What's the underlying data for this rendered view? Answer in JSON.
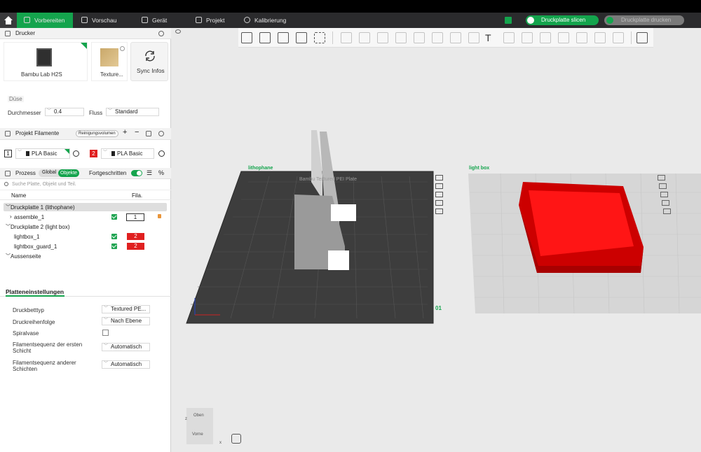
{
  "menubar": {
    "tabs": [
      {
        "label": "Vorbereiten"
      },
      {
        "label": "Vorschau"
      },
      {
        "label": "Gerät"
      },
      {
        "label": "Projekt"
      },
      {
        "label": "Kalibrierung"
      }
    ],
    "slice_button": "Druckplatte slicen",
    "print_button": "Druckplatte drucken"
  },
  "printer": {
    "section_title": "Drucker",
    "printer_name": "Bambu Lab H2S",
    "plate_name": "Texture...",
    "sync_label": "Sync Infos",
    "nozzle_label": "Düse",
    "diameter_label": "Durchmesser",
    "diameter_value": "0.4",
    "flow_label": "Fluss",
    "flow_value": "Standard"
  },
  "filaments": {
    "section_title": "Projekt Filamente",
    "purge_badge": "Reinigungsvolumen",
    "items": [
      {
        "index": "1",
        "name": "PLA Basic",
        "color": "#ffffff"
      },
      {
        "index": "2",
        "name": "PLA Basic",
        "color": "#e02020"
      }
    ]
  },
  "process": {
    "section_title": "Prozess",
    "global_label": "Global",
    "objects_label": "Objekte",
    "advanced_label": "Fortgeschritten",
    "search_placeholder": "Suche Platte, Objekt und Teil.",
    "col_name": "Name",
    "col_fila": "Fila."
  },
  "tree": {
    "plate1": "Druckplatte 1 (lithophane)",
    "assemble": "assemble_1",
    "assemble_fila": "1",
    "plate2": "Druckplatte 2 (light box)",
    "lightbox": "lightbox_1",
    "lightbox_fila": "2",
    "guard": "lightbox_guard_1",
    "guard_fila": "2",
    "outside": "Aussenseite"
  },
  "plate_settings": {
    "title": "Platteneinstellungen",
    "rows": [
      {
        "label": "Druckbetttyp",
        "value": "Textured PE..."
      },
      {
        "label": "Druckreihenfolge",
        "value": "Nach Ebene"
      },
      {
        "label": "Spiralvase",
        "value": ""
      },
      {
        "label": "Filamentsequenz der ersten Schicht",
        "value": "Automatisch"
      },
      {
        "label": "Filamentsequenz anderer Schichten",
        "value": "Automatisch"
      }
    ]
  },
  "viewport": {
    "plate1_label": "lithophane",
    "plate2_label": "light box",
    "plate_text": "Bambu Textured PEI Plate",
    "plate_number": "01",
    "cube_top": "Oben",
    "cube_front": "Vorne",
    "axis_x": "x",
    "axis_z": "z"
  },
  "colors": {
    "accent": "#14a44d",
    "filament2": "#e02020",
    "plate": "#3d3d3d"
  }
}
